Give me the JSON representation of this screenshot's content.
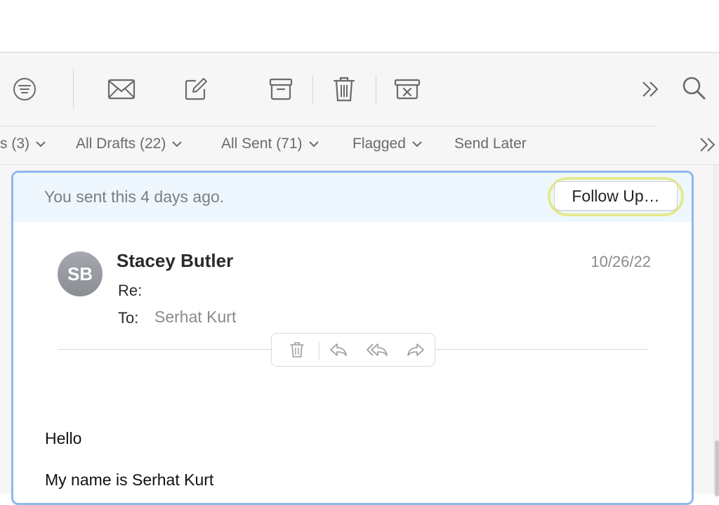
{
  "toolbar": {
    "buttons": [
      {
        "icon": "filter-icon"
      },
      {
        "icon": "envelope-icon"
      },
      {
        "icon": "compose-icon"
      },
      {
        "icon": "archive-icon"
      },
      {
        "icon": "trash-icon"
      },
      {
        "icon": "junk-icon"
      },
      {
        "icon": "double-chevron-right-icon"
      },
      {
        "icon": "search-icon"
      }
    ]
  },
  "favorites_bar": {
    "items": [
      {
        "label": "s (3)",
        "has_menu": true
      },
      {
        "label": "All Drafts (22)",
        "has_menu": true
      },
      {
        "label": "All Sent (71)",
        "has_menu": true
      },
      {
        "label": "Flagged",
        "has_menu": true
      },
      {
        "label": "Send Later",
        "has_menu": false
      }
    ]
  },
  "message": {
    "banner": {
      "text": "You sent this 4 days ago.",
      "button_label": "Follow Up…"
    },
    "avatar_initials": "SB",
    "sender": "Stacey Butler",
    "date": "10/26/22",
    "re_label": "Re:",
    "subject": "",
    "to_label": "To:",
    "to_value": "Serhat Kurt",
    "body": [
      "Hello",
      "My name is Serhat Kurt"
    ]
  },
  "colors": {
    "selection_border": "#8db8ef",
    "banner_bg": "#eef7fd",
    "highlight_ring": "#e5e98e"
  }
}
